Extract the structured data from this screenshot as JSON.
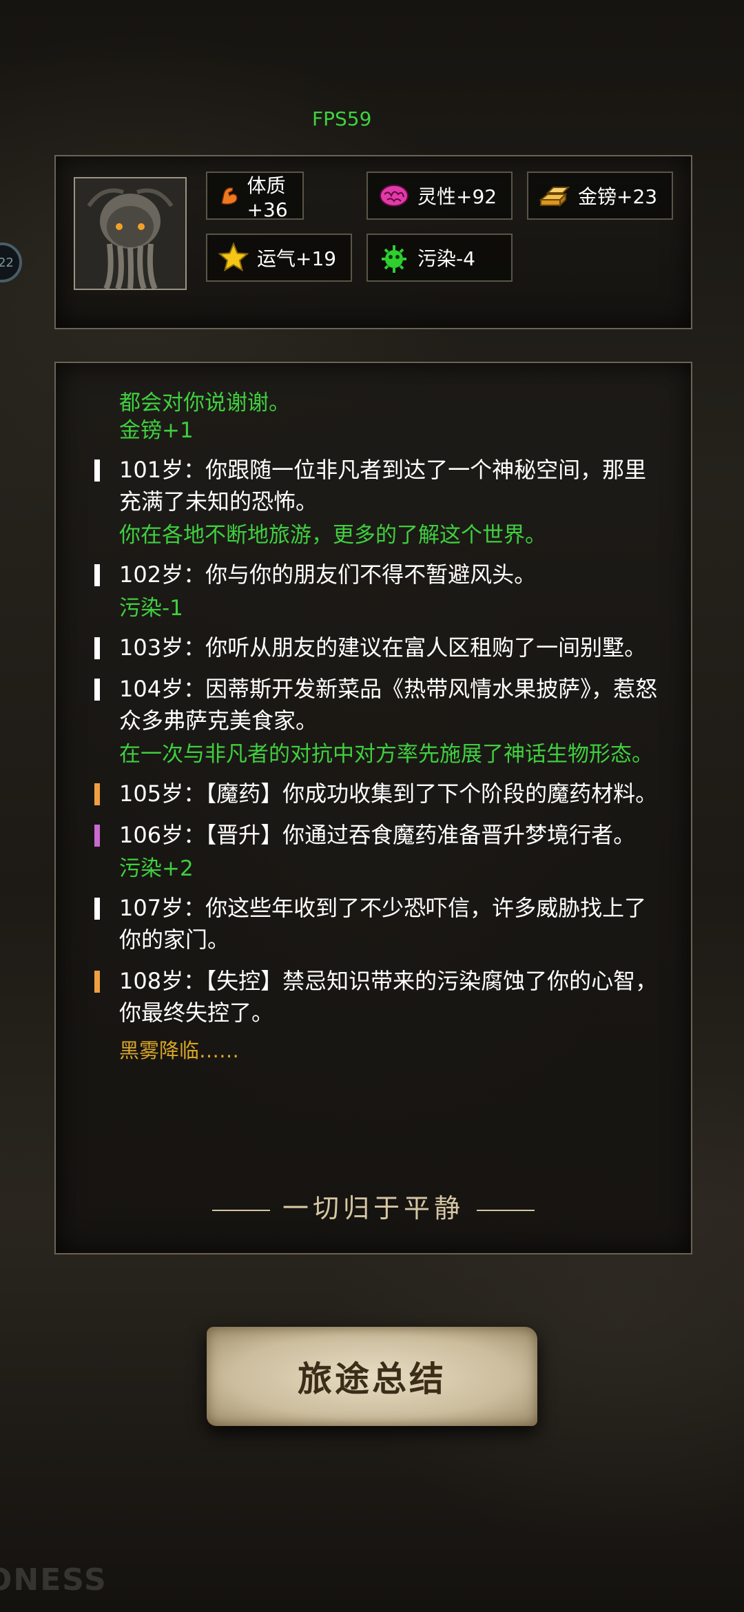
{
  "hud": {
    "fps": "FPS59",
    "side_badge": "22"
  },
  "stats": [
    {
      "label": "体质+36",
      "icon": "muscle-arm-icon",
      "color": "#f0781e"
    },
    {
      "label": "灵性+92",
      "icon": "brain-icon",
      "color": "#e23aa8"
    },
    {
      "label": "金镑+23",
      "icon": "gold-bars-icon",
      "color": "#e6a527"
    },
    {
      "label": "运气+19",
      "icon": "star-icon",
      "color": "#f5c518"
    },
    {
      "label": "污染-4",
      "icon": "virus-icon",
      "color": "#2fcf2f"
    }
  ],
  "log": {
    "top_effect_text": "都会对你说谢谢。",
    "top_effect_gain": "金镑+1",
    "entries": [
      {
        "text": "101岁：你跟随一位非凡者到达了一个神秘空间，那里充满了未知的恐怖。",
        "bar": "#ffffff"
      },
      {
        "text": "102岁：你与你的朋友们不得不暂避风头。",
        "bar": "#ffffff"
      },
      {
        "text": "103岁：你听从朋友的建议在富人区租购了一间别墅。",
        "bar": "#ffffff"
      },
      {
        "text": "104岁：因蒂斯开发新菜品《热带风情水果披萨》，惹怒众多弗萨克美食家。",
        "bar": "#ffffff"
      },
      {
        "text": "105岁：【魔药】你成功收集到了下个阶段的魔药材料。",
        "bar": "#f0a040"
      },
      {
        "text": "106岁：【晋升】你通过吞食魔药准备晋升梦境行者。",
        "bar": "#c86ad0"
      },
      {
        "text": "107岁：你这些年收到了不少恐吓信，许多威胁找上了你的家门。",
        "bar": "#ffffff"
      },
      {
        "text": "108岁：【失控】禁忌知识带来的污染腐蚀了你的心智，你最终失控了。",
        "bar": "#f0a040"
      }
    ],
    "effects": {
      "e101": "你在各地不断地旅游，更多的了解这个世界。",
      "e102": "污染-1",
      "e104": "在一次与非凡者的对抗中对方率先施展了神话生物形态。",
      "e106": "污染+2",
      "e108": "黑雾降临……"
    },
    "ending": "一切归于平静"
  },
  "actions": {
    "summary_button": "旅途总结"
  },
  "watermark": "ONESS",
  "colors": {
    "effect_green": "#3fcf3f",
    "effect_gold": "#d9a528",
    "button_parchment": "#cbbd9d"
  }
}
